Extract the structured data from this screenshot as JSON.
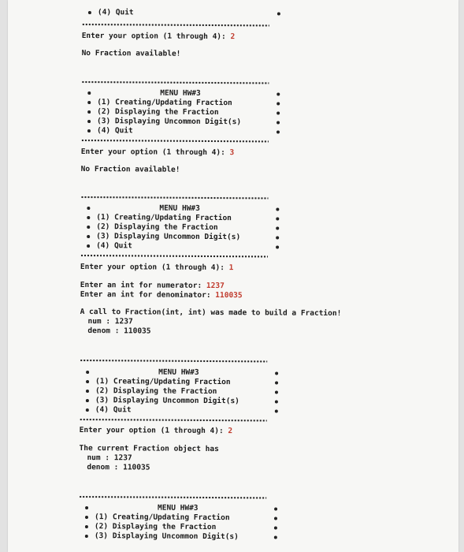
{
  "block0": {
    "quit_line": "(4) Quit",
    "prompt": "Enter your option (1 through 4): ",
    "prompt_input": "2",
    "message": "No Fraction available!"
  },
  "menu": {
    "title": "MENU HW#3",
    "items": [
      "(1) Creating/Updating Fraction",
      "(2) Displaying the Fraction",
      "(3) Displaying Uncommon Digit(s)",
      "(4) Quit"
    ],
    "prompt": "Enter your option (1 through 4): "
  },
  "block1": {
    "prompt_input": "3",
    "message": "No Fraction available!"
  },
  "block2": {
    "prompt_input": "1",
    "numerator_prompt": "Enter an int for numerator: ",
    "numerator_input": "1237",
    "denominator_prompt": "Enter an int for denominator: ",
    "denominator_input": "110035",
    "call_message": "A call to Fraction(int, int) was made to build a Fraction!",
    "num_line": "num : 1237",
    "denom_line": "denom : 110035"
  },
  "block3": {
    "prompt_input": "2",
    "current_message": "The current Fraction object has",
    "num_line": "num : 1237",
    "denom_line": "denom : 110035"
  },
  "colors": {
    "user_input": "#c0392b",
    "text": "#1a1a1a",
    "paper": "#f7f7f5"
  }
}
